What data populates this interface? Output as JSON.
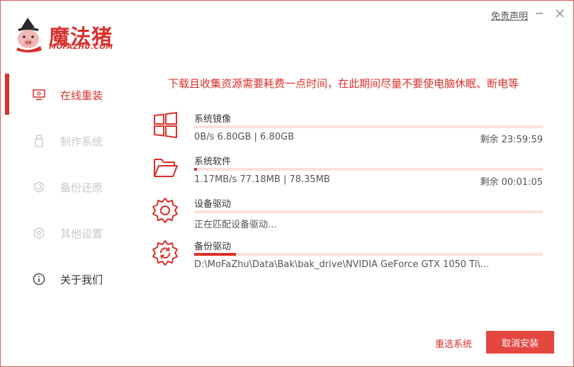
{
  "app": {
    "title": "魔法猪",
    "subtitle": "MOFAZHU.COM"
  },
  "titlebar": {
    "disclaimer": "免责声明"
  },
  "sidebar": {
    "items": [
      {
        "label": "在线重装",
        "icon": "monitor-icon",
        "state": "active"
      },
      {
        "label": "制作系统",
        "icon": "usb-icon",
        "state": "disabled"
      },
      {
        "label": "备份还原",
        "icon": "backup-icon",
        "state": "disabled"
      },
      {
        "label": "其他设置",
        "icon": "gear-icon",
        "state": "disabled"
      },
      {
        "label": "关于我们",
        "icon": "info-icon",
        "state": "normal"
      }
    ]
  },
  "main": {
    "notice": "下载且收集资源需要耗费一点时间，在此期间尽量不要使电脑休眠、断电等",
    "tasks": [
      {
        "name": "系统镜像",
        "detail": "0B/s 6.80GB | 6.80GB",
        "remaining": "剩余 23:59:59",
        "progress": 0.0,
        "icon": "windows-icon"
      },
      {
        "name": "系统软件",
        "detail": "1.17MB/s 77.18MB | 78.35MB",
        "remaining": "剩余 00:01:05",
        "progress": 0.008,
        "icon": "folder-icon"
      },
      {
        "name": "设备驱动",
        "detail": "正在匹配设备驱动...",
        "remaining": "",
        "progress": 0.0,
        "icon": "gear-icon"
      },
      {
        "name": "备份驱动",
        "detail": "D:\\MoFaZhu\\Data\\Bak\\bak_drive\\NVIDIA GeForce GTX 1050 Ti\\...",
        "remaining": "",
        "progress": 0.12,
        "icon": "refresh-gear-icon"
      }
    ]
  },
  "footer": {
    "reselect_label": "重选系统",
    "cancel_label": "取消安装"
  },
  "colors": {
    "accent": "#d9302b",
    "track": "#fbe0de",
    "button": "#e3473f"
  }
}
